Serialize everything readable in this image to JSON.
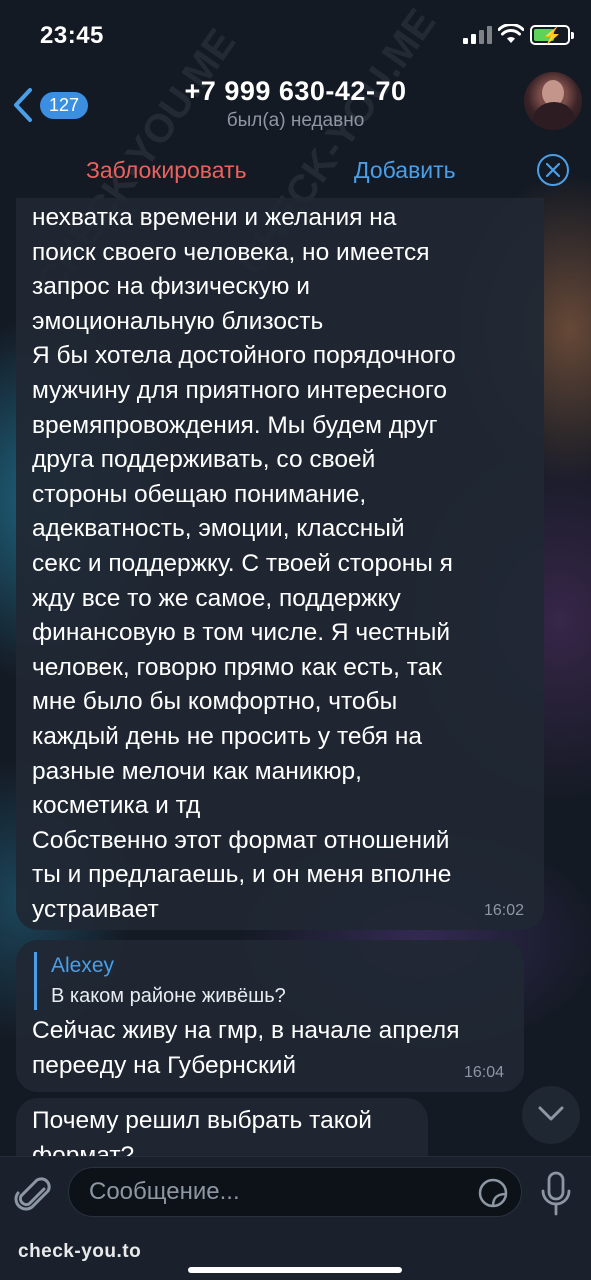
{
  "status_bar": {
    "time": "23:45"
  },
  "header": {
    "unread_count": "127",
    "contact_phone": "+7 999 630-42-70",
    "contact_status": "был(а) недавно"
  },
  "action_bar": {
    "block_label": "Заблокировать",
    "add_label": "Добавить"
  },
  "messages": [
    {
      "text": "нехватка времени и желания на\nпоиск своего человека, но имеется\nзапрос на физическую и\nэмоциональную близость\nЯ бы хотела достойного порядочного\nмужчину для приятного интересного\nвремяпровождения. Мы будем друг\nдруга поддерживать, со своей\nстороны обещаю понимание,\nадекватность, эмоции, классный\nсекс и поддержку. С твоей стороны я\nжду все то же самое, поддержку\nфинансовую в том числе. Я честный\nчеловек, говорю прямо как есть, так\nмне было бы комфортно, чтобы\nкаждый день не просить у тебя на\nразные мелочи как маникюр,\nкосметика и тд\nСобственно этот формат отношений\nты и предлагаешь, и он меня вполне\nустраивает",
      "time": "16:02"
    },
    {
      "reply_author": "Alexey",
      "reply_text": "В каком районе живёшь?",
      "text": "Сейчас живу на гмр, в начале апреля\nпереeду на Губернский",
      "time": "16:04"
    },
    {
      "text": "Почему решил выбрать такой\nформат?"
    }
  ],
  "input_bar": {
    "placeholder": "Сообщение..."
  },
  "watermark": {
    "bottom": "check-you.to",
    "diagonal": "CHECK-YOU.ME"
  },
  "colors": {
    "accent": "#4a9fe8",
    "destructive": "#e8625f",
    "bubble": "#202834",
    "badge": "#3c8ee0"
  },
  "icons": [
    "back-chevron-icon",
    "close-circle-icon",
    "chevron-down-icon",
    "paperclip-icon",
    "sticker-icon",
    "microphone-icon",
    "signal-icon",
    "wifi-icon",
    "battery-icon"
  ]
}
